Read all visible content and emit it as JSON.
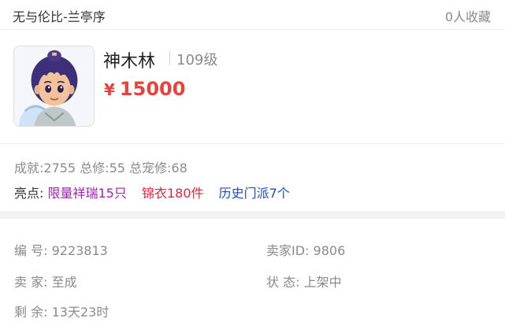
{
  "header": {
    "server": "无与伦比-兰亭序",
    "favorites": "0人收藏"
  },
  "role": {
    "name": "神木林",
    "level": "109级",
    "currency": "¥",
    "price": "15000"
  },
  "stats": {
    "text": "成就:2755 总修:55 总宠修:68"
  },
  "highlights": {
    "label": "亮点:",
    "items": [
      "限量祥瑞15只",
      "锦衣180件",
      "历史门派7个"
    ]
  },
  "details": {
    "id_label": "编 号:",
    "id_value": "9223813",
    "seller_id_label": "卖家ID:",
    "seller_id_value": "9806",
    "seller_label": "卖 家:",
    "seller_value": "至成",
    "status_label": "状 态:",
    "status_value": "上架中",
    "remain_label": "剩 余:",
    "remain_value": "13天23时"
  },
  "colors": {
    "price": "#e8423f",
    "highlight_purple": "#a221b5",
    "highlight_red": "#e3223a",
    "highlight_blue": "#1f4cc4"
  }
}
